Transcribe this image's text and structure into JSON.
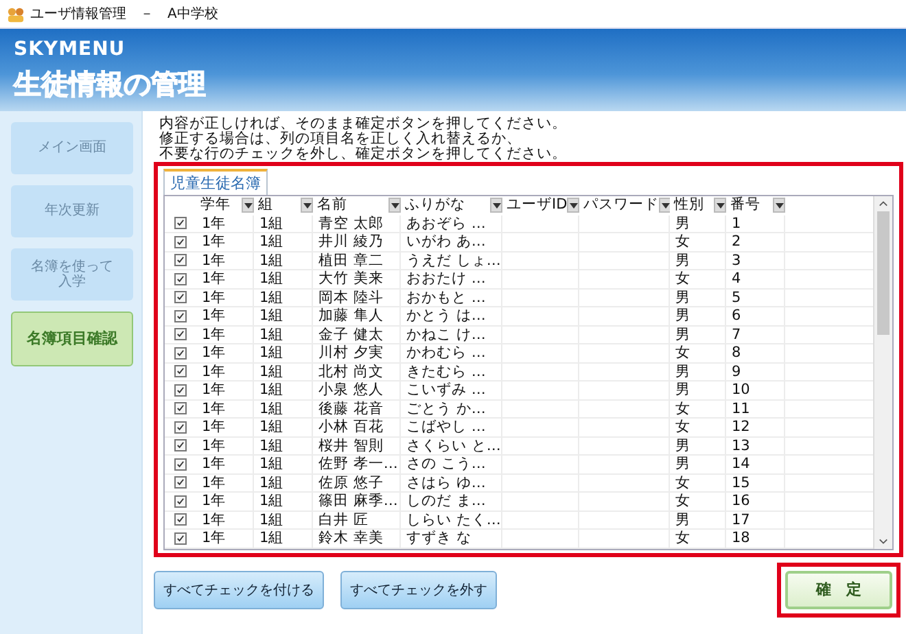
{
  "window": {
    "title": "ユーザ情報管理　－　A中学校"
  },
  "header": {
    "logo": "SKYMENU",
    "title": "生徒情報の管理"
  },
  "sidebar": {
    "items": [
      {
        "lines": [
          "メイン画面"
        ],
        "selected": false
      },
      {
        "lines": [
          "年次更新"
        ],
        "selected": false
      },
      {
        "lines": [
          "名簿を使って",
          "入学"
        ],
        "selected": false
      },
      {
        "lines": [
          "名簿項目確認"
        ],
        "selected": true
      }
    ]
  },
  "instructions": [
    "内容が正しければ、そのまま確定ボタンを押してください。",
    "修正する場合は、列の項目名を正しく入れ替えるか、",
    "不要な行のチェックを外し、確定ボタンを押してください。"
  ],
  "tabs": [
    {
      "label": "児童生徒名簿",
      "selected": true
    }
  ],
  "table": {
    "columns": [
      "学年",
      "組",
      "名前",
      "ふりがな",
      "ユーザID",
      "パスワード",
      "性別",
      "番号"
    ],
    "rows": [
      {
        "checked": true,
        "cells": [
          "1年",
          "1組",
          "青空 太郎",
          "あおぞら …",
          "",
          "",
          "男",
          "1"
        ]
      },
      {
        "checked": true,
        "cells": [
          "1年",
          "1組",
          "井川 綾乃",
          "いがわ あ…",
          "",
          "",
          "女",
          "2"
        ]
      },
      {
        "checked": true,
        "cells": [
          "1年",
          "1組",
          "植田 章二",
          "うえだ しょ…",
          "",
          "",
          "男",
          "3"
        ]
      },
      {
        "checked": true,
        "cells": [
          "1年",
          "1組",
          "大竹 美来",
          "おおたけ …",
          "",
          "",
          "女",
          "4"
        ]
      },
      {
        "checked": true,
        "cells": [
          "1年",
          "1組",
          "岡本 陸斗",
          "おかもと …",
          "",
          "",
          "男",
          "5"
        ]
      },
      {
        "checked": true,
        "cells": [
          "1年",
          "1組",
          "加藤 隼人",
          "かとう は…",
          "",
          "",
          "男",
          "6"
        ]
      },
      {
        "checked": true,
        "cells": [
          "1年",
          "1組",
          "金子 健太",
          "かねこ け…",
          "",
          "",
          "男",
          "7"
        ]
      },
      {
        "checked": true,
        "cells": [
          "1年",
          "1組",
          "川村 夕実",
          "かわむら …",
          "",
          "",
          "女",
          "8"
        ]
      },
      {
        "checked": true,
        "cells": [
          "1年",
          "1組",
          "北村 尚文",
          "きたむら …",
          "",
          "",
          "男",
          "9"
        ]
      },
      {
        "checked": true,
        "cells": [
          "1年",
          "1組",
          "小泉 悠人",
          "こいずみ …",
          "",
          "",
          "男",
          "10"
        ]
      },
      {
        "checked": true,
        "cells": [
          "1年",
          "1組",
          "後藤 花音",
          "ごとう か…",
          "",
          "",
          "女",
          "11"
        ]
      },
      {
        "checked": true,
        "cells": [
          "1年",
          "1組",
          "小林 百花",
          "こばやし …",
          "",
          "",
          "女",
          "12"
        ]
      },
      {
        "checked": true,
        "cells": [
          "1年",
          "1組",
          "桜井 智則",
          "さくらい と…",
          "",
          "",
          "男",
          "13"
        ]
      },
      {
        "checked": true,
        "cells": [
          "1年",
          "1組",
          "佐野 孝一…",
          "さの こう…",
          "",
          "",
          "男",
          "14"
        ]
      },
      {
        "checked": true,
        "cells": [
          "1年",
          "1組",
          "佐原 悠子",
          "さはら ゆ…",
          "",
          "",
          "女",
          "15"
        ]
      },
      {
        "checked": true,
        "cells": [
          "1年",
          "1組",
          "篠田 麻季…",
          "しのだ ま…",
          "",
          "",
          "女",
          "16"
        ]
      },
      {
        "checked": true,
        "cells": [
          "1年",
          "1組",
          "白井 匠",
          "しらい たく…",
          "",
          "",
          "男",
          "17"
        ]
      },
      {
        "checked": true,
        "cells": [
          "1年",
          "1組",
          "鈴木 幸美",
          "すずき な",
          "",
          "",
          "女",
          "18"
        ]
      }
    ]
  },
  "buttons": {
    "check_all": "すべてチェックを付ける",
    "uncheck_all": "すべてチェックを外す",
    "confirm": "確　定"
  }
}
